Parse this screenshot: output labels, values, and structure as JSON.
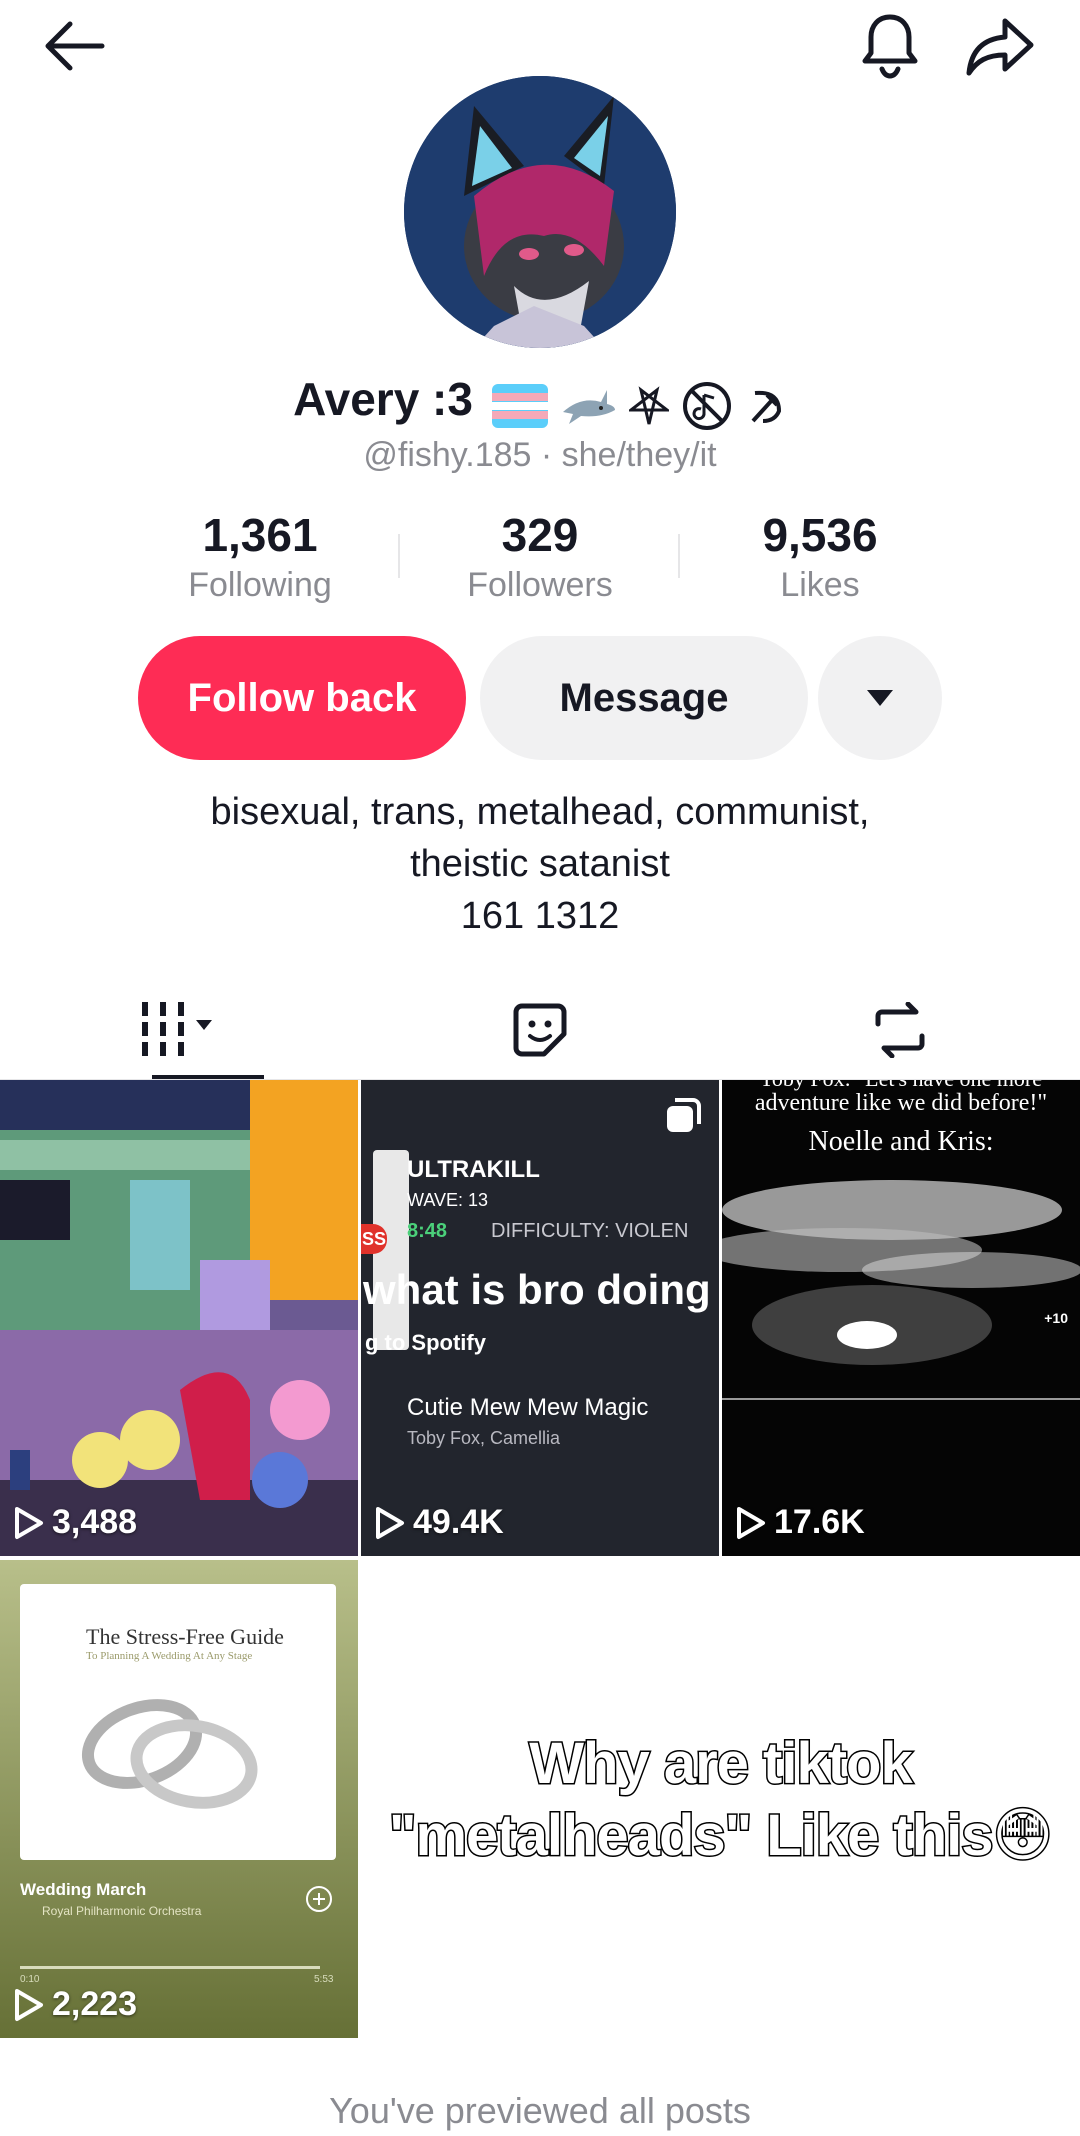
{
  "header": {
    "back_icon": "arrow-left-icon",
    "bell_icon": "bell-icon",
    "share_icon": "share-arrow-icon"
  },
  "profile": {
    "display_name": "Avery :3",
    "badges": [
      "trans-flag",
      "shark",
      "inverted-pentagram",
      "no-music",
      "hammer-sickle"
    ],
    "handle_line": "@fishy.185 · she/they/it",
    "stats": [
      {
        "value": "1,361",
        "label": "Following"
      },
      {
        "value": "329",
        "label": "Followers"
      },
      {
        "value": "9,536",
        "label": "Likes"
      }
    ],
    "bio_lines": [
      "bisexual, trans, metalhead, communist,",
      "theistic satanist",
      "161 1312"
    ]
  },
  "actions": {
    "follow_back": "Follow back",
    "message": "Message",
    "more_icon": "caret-down-icon"
  },
  "tabs": [
    {
      "name": "videos",
      "icon": "grid-icon"
    },
    {
      "name": "favorites",
      "icon": "sticker-icon"
    },
    {
      "name": "reposts",
      "icon": "repost-icon"
    }
  ],
  "posts": [
    {
      "views": "3,488"
    },
    {
      "views": "49.4K",
      "game": "ULTRAKILL",
      "wave": "WAVE: 13",
      "time": "8:48",
      "difficulty": "DIFFICULTY: VIOLEN",
      "badge": "SS",
      "caption": "what is bro doing",
      "spotify": "g to Spotify",
      "song": "Cutie Mew Mew Magic",
      "artist": "Toby Fox, Camellia"
    },
    {
      "views": "17.6K",
      "line1": "Toby Fox: \"Let's have one more",
      "line2": "adventure like we did before!\"",
      "line3": "Noelle and Kris:",
      "plus": "+10"
    },
    {
      "views": "2,223",
      "book_title": "The Stress-Free Guide",
      "book_subtitle": "To Planning A Wedding At Any Stage",
      "track": "Wedding March",
      "artist": "Royal Philharmonic Orchestra",
      "time_start": "0:10",
      "time_end": "5:53"
    },
    {
      "meme_line1": "Why are tiktok",
      "meme_line2": "\"metalheads\" Like this😳"
    }
  ],
  "footer": {
    "text": "You've previewed all posts"
  },
  "colors": {
    "accent": "#fe2c55",
    "secondary_btn": "#f1f1f2",
    "muted_text": "#8a8b91"
  }
}
